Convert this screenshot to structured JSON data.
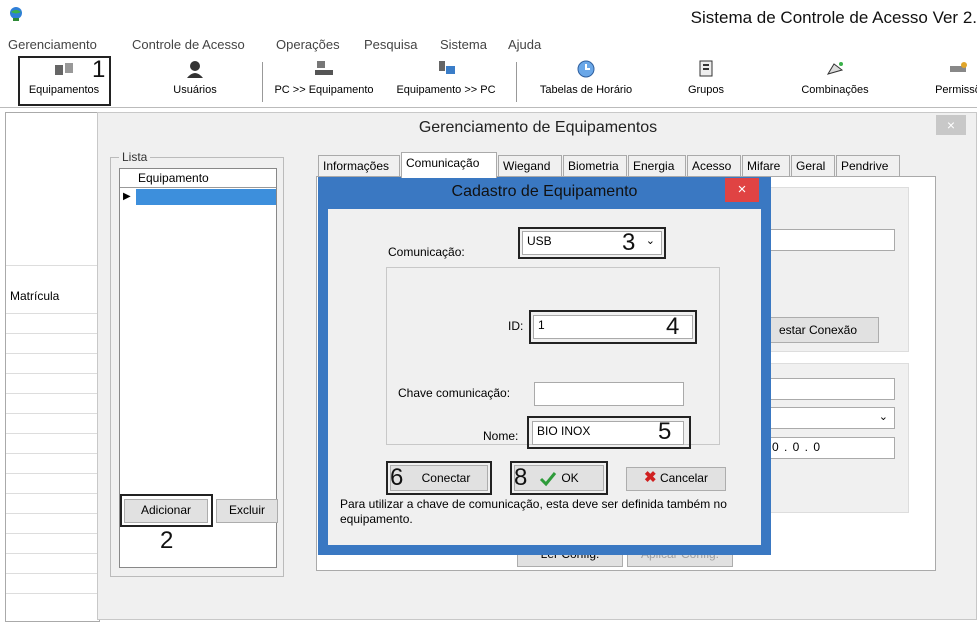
{
  "app": {
    "title": "Sistema de Controle de Acesso  Ver 2."
  },
  "menu": [
    "Gerenciamento",
    "Controle de Acesso",
    "Operações",
    "Pesquisa",
    "Sistema",
    "Ajuda"
  ],
  "toolbar": {
    "equipamentos": "Equipamentos",
    "usuarios": "Usuários",
    "pc_to_equip": "PC >> Equipamento",
    "equip_to_pc": "Equipamento >> PC",
    "tabelas": "Tabelas de Horário",
    "grupos": "Grupos",
    "combinacoes": "Combinações",
    "permissoes": "Permissõ"
  },
  "background": {
    "matricula": "Matrícula"
  },
  "manager": {
    "title": "Gerenciamento de Equipamentos",
    "close": "×",
    "lista_label": "Lista",
    "lista_column": "Equipamento",
    "add_button": "Adicionar",
    "remove_button": "Excluir",
    "tabs": [
      "Informações",
      "Comunicação",
      "Wiegand",
      "Biometria",
      "Energia",
      "Acesso",
      "Mifare",
      "Geral",
      "Pendrive"
    ],
    "test_connection": "estar Conexão",
    "ip_value": "0  .  0  .  0",
    "read_config": "Ler Config.",
    "apply_config": "Aplicar Config."
  },
  "modal": {
    "title": "Cadastro de Equipamento",
    "close": "×",
    "comunicacao_label": "Comunicação:",
    "comunicacao_value": "USB",
    "id_label": "ID:",
    "id_value": "1",
    "chave_label": "Chave comunicação:",
    "chave_value": "",
    "nome_label": "Nome:",
    "nome_value": "BIO INOX",
    "connect_button": "Conectar",
    "ok_button": "OK",
    "cancel_button": "Cancelar",
    "note": "Para utilizar a chave de comunicação, esta deve ser definida também no equipamento."
  },
  "callouts": [
    "1",
    "2",
    "3",
    "4",
    "5",
    "6",
    "8"
  ],
  "colors": {
    "modal_border": "#3a78c2",
    "selection": "#3d8fdc",
    "close_red": "#e04343",
    "ok_check": "#2e9b3a",
    "cancel_x": "#d02020"
  }
}
